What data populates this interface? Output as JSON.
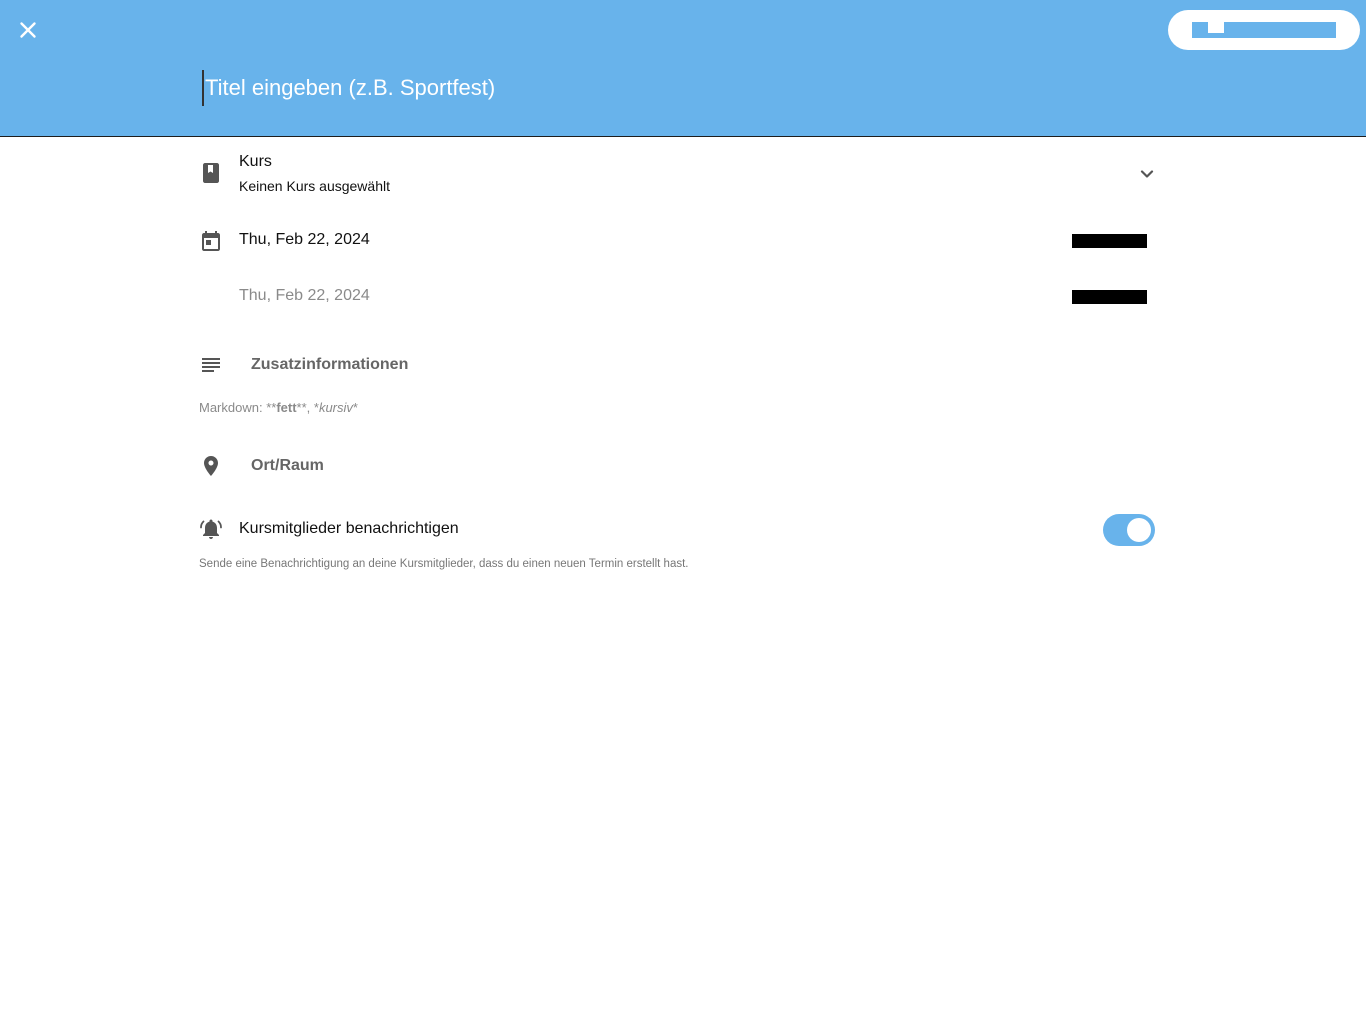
{
  "header": {
    "close_icon": "close-icon",
    "title_placeholder": "Titel eingeben (z.B. Sportfest)",
    "title_value": "",
    "accent_color": "#68b3eb"
  },
  "course": {
    "icon": "book-icon",
    "label": "Kurs",
    "value": "Keinen Kurs ausgewählt",
    "chevron_icon": "chevron-down-icon"
  },
  "dates": {
    "icon": "calendar-icon",
    "start_date": "Thu, Feb 22, 2024",
    "end_date": "Thu, Feb 22, 2024"
  },
  "description": {
    "icon": "notes-icon",
    "label": "Zusatzinformationen",
    "hint_prefix": "Markdown: **",
    "hint_bold": "fett",
    "hint_middle": "**, *",
    "hint_italic": "kursiv",
    "hint_suffix": "*"
  },
  "location": {
    "icon": "location-pin-icon",
    "label": "Ort/Raum"
  },
  "notify": {
    "icon": "bell-icon",
    "label": "Kursmitglieder benachrichtigen",
    "enabled": true,
    "hint": "Sende eine Benachrichtigung an deine Kursmitglieder, dass du einen neuen Termin erstellt hast."
  }
}
